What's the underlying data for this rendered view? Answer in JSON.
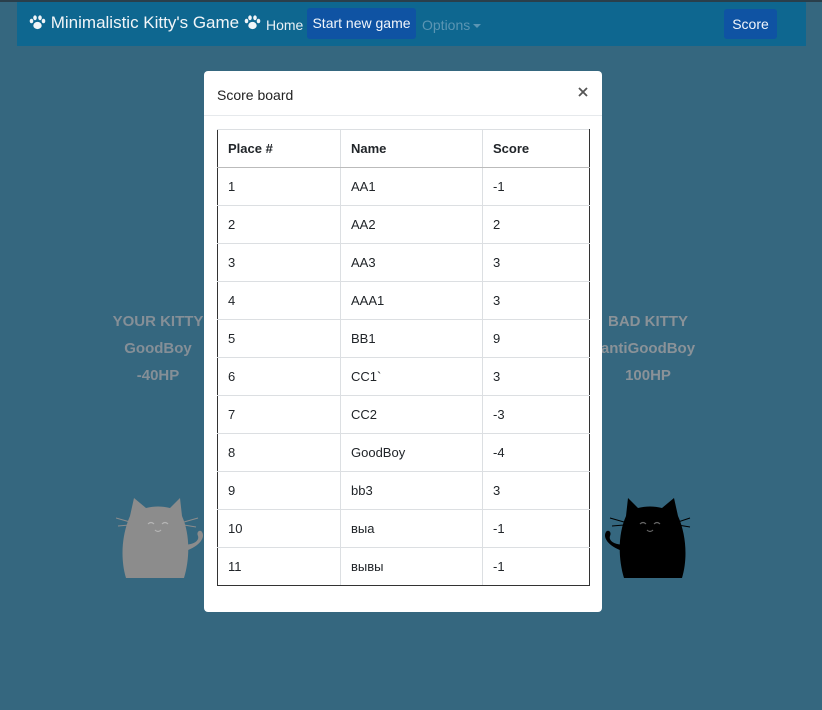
{
  "navbar": {
    "brand": "Minimalistic Kitty's Game",
    "home": "Home",
    "start_new_game": "Start new game",
    "options": "Options",
    "score": "Score",
    "icons": [
      "paw-icon",
      "paw-icon",
      "caret-down-icon"
    ]
  },
  "your_kitty": {
    "heading": "YOUR KITTY",
    "name": "GoodBoy",
    "hp": "-40HP"
  },
  "bad_kitty": {
    "heading": "BAD KITTY",
    "name": "antiGoodBoy",
    "hp": "100HP"
  },
  "modal": {
    "title": "Score board",
    "close_icon": "close-icon",
    "columns": [
      "Place #",
      "Name",
      "Score"
    ],
    "rows": [
      [
        "1",
        "AA1",
        "-1"
      ],
      [
        "2",
        "AA2",
        "2"
      ],
      [
        "3",
        "AA3",
        "3"
      ],
      [
        "4",
        "AAA1",
        "3"
      ],
      [
        "5",
        "BB1",
        "9"
      ],
      [
        "6",
        "CC1`",
        "3"
      ],
      [
        "7",
        "CC2",
        "-3"
      ],
      [
        "8",
        "GoodBoy",
        "-4"
      ],
      [
        "9",
        "bb3",
        "3"
      ],
      [
        "10",
        "выа",
        "-1"
      ],
      [
        "11",
        "вывы",
        "-1"
      ]
    ]
  },
  "colors": {
    "background": "#35677f",
    "navbar": "#0e6790",
    "button": "#0f53a3",
    "your_kitty": "#8c8c8c",
    "bad_kitty": "#000000"
  }
}
